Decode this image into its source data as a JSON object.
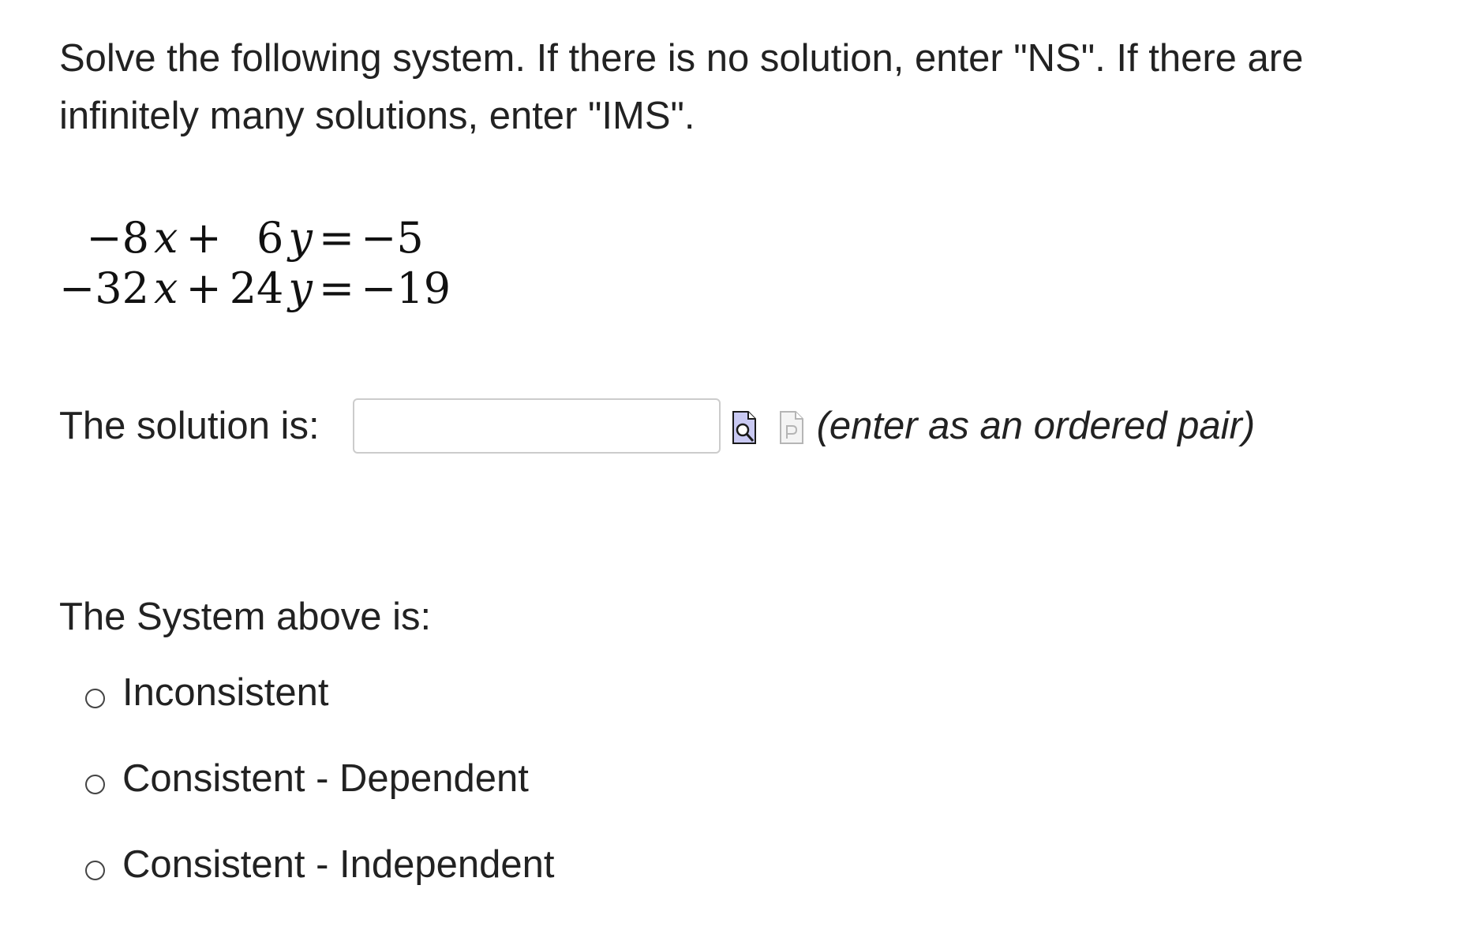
{
  "question": {
    "prompt": "Solve the following system. If there is no solution, enter \"NS\". If there are infinitely many solutions, enter \"IMS\"."
  },
  "equations": [
    {
      "x_coef": "−8",
      "x_var": "x",
      "op": "+",
      "y_coef": "6",
      "y_var": "y",
      "equals": "=",
      "rhs": "−5"
    },
    {
      "x_coef": "−32",
      "x_var": "x",
      "op": "+",
      "y_coef": "24",
      "y_var": "y",
      "equals": "=",
      "rhs": "−19"
    }
  ],
  "solution": {
    "label": "The solution is:",
    "value": "",
    "placeholder": "",
    "hint": "(enter as an ordered pair)"
  },
  "icons": {
    "preview": "preview-answer-icon",
    "format": "format-help-icon"
  },
  "system_classification": {
    "label": "The System above is:",
    "options": [
      {
        "label": "Inconsistent",
        "selected": false
      },
      {
        "label": "Consistent - Dependent",
        "selected": false
      },
      {
        "label": "Consistent - Independent",
        "selected": false
      }
    ]
  }
}
